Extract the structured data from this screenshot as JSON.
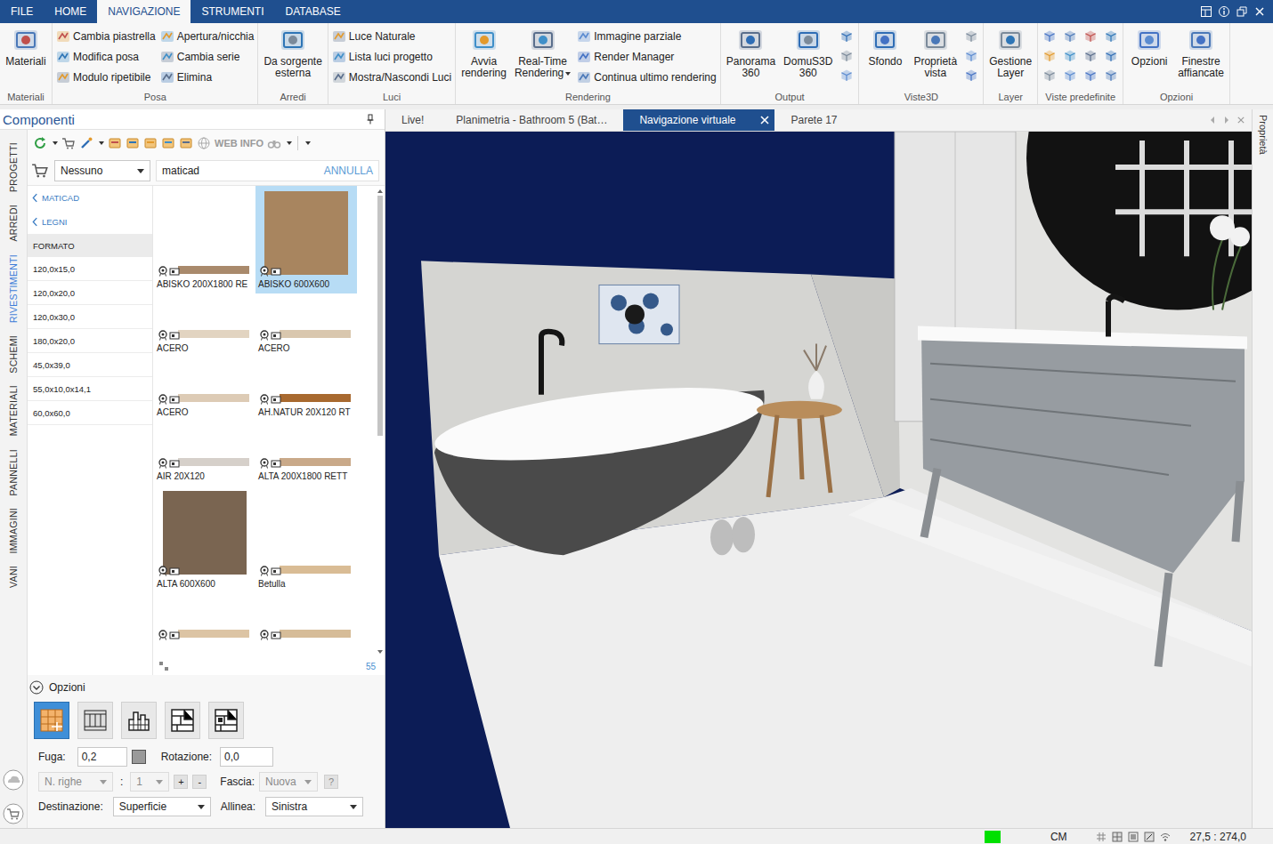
{
  "app_tabs": [
    {
      "label": "FILE",
      "selected": false
    },
    {
      "label": "HOME",
      "selected": false
    },
    {
      "label": "NAVIGAZIONE",
      "selected": true
    },
    {
      "label": "STRUMENTI",
      "selected": false
    },
    {
      "label": "DATABASE",
      "selected": false
    }
  ],
  "ribbon_groups": [
    {
      "title": "Materiali",
      "items": [
        {
          "kind": "large",
          "lines": [
            "Materiali"
          ],
          "dropdown": false
        }
      ]
    },
    {
      "title": "Posa",
      "items": [
        {
          "kind": "column",
          "buttons": [
            "Cambia piastrella",
            "Modifica posa",
            "Modulo ripetibile"
          ]
        },
        {
          "kind": "column",
          "buttons": [
            "Apertura/nicchia",
            "Cambia serie",
            "Elimina"
          ]
        }
      ]
    },
    {
      "title": "Arredi",
      "items": [
        {
          "kind": "large",
          "lines": [
            "Da sorgente",
            "esterna"
          ],
          "dropdown": false
        }
      ]
    },
    {
      "title": "Luci",
      "items": [
        {
          "kind": "column",
          "buttons": [
            "Luce Naturale",
            "Lista luci progetto",
            "Mostra/Nascondi Luci"
          ]
        }
      ]
    },
    {
      "title": "Rendering",
      "items": [
        {
          "kind": "large",
          "lines": [
            "Avvia",
            "rendering"
          ],
          "dropdown": false
        },
        {
          "kind": "large",
          "lines": [
            "Real-Time",
            "Rendering"
          ],
          "dropdown": true
        },
        {
          "kind": "column",
          "buttons": [
            "Immagine parziale",
            "Render Manager",
            "Continua ultimo rendering"
          ]
        }
      ]
    },
    {
      "title": "Output",
      "items": [
        {
          "kind": "large",
          "lines": [
            "Panorama",
            "360"
          ],
          "dropdown": false
        },
        {
          "kind": "large",
          "lines": [
            "DomuS3D",
            "360"
          ],
          "dropdown": false
        },
        {
          "kind": "icons",
          "columns": 1,
          "icons": 3
        }
      ]
    },
    {
      "title": "Viste3D",
      "items": [
        {
          "kind": "large",
          "lines": [
            "Sfondo"
          ],
          "dropdown": false
        },
        {
          "kind": "large",
          "lines": [
            "Proprietà",
            "vista"
          ],
          "dropdown": false
        },
        {
          "kind": "icons",
          "columns": 1,
          "icons": 3
        }
      ]
    },
    {
      "title": "Layer",
      "items": [
        {
          "kind": "large",
          "lines": [
            "Gestione",
            "Layer"
          ],
          "dropdown": false
        }
      ]
    },
    {
      "title": "Viste predefinite",
      "items": [
        {
          "kind": "icons",
          "columns": 4,
          "icons": 12
        }
      ]
    },
    {
      "title": "Opzioni",
      "items": [
        {
          "kind": "large",
          "lines": [
            "Opzioni"
          ],
          "dropdown": false
        },
        {
          "kind": "large",
          "lines": [
            "Finestre",
            "affiancate"
          ],
          "dropdown": false
        }
      ]
    }
  ],
  "panel": {
    "title": "Componenti",
    "side_tabs": [
      {
        "label": "PROGETTI",
        "selected": false
      },
      {
        "label": "ARREDI",
        "selected": false
      },
      {
        "label": "RIVESTIMENTI",
        "selected": true
      },
      {
        "label": "SCHEMI",
        "selected": false
      },
      {
        "label": "MATERIALI",
        "selected": false
      },
      {
        "label": "PANNELLI",
        "selected": false
      },
      {
        "label": "IMMAGINI",
        "selected": false
      },
      {
        "label": "VANI",
        "selected": false
      }
    ],
    "web_info": "WEB INFO",
    "filter": {
      "catalog": "Nessuno",
      "search": "maticad",
      "cancel": "ANNULLA"
    },
    "breadcrumbs": [
      "MATICAD",
      "LEGNI"
    ],
    "category": {
      "title": "FORMATO",
      "items": [
        "120,0x15,0",
        "120,0x20,0",
        "120,0x30,0",
        "180,0x20,0",
        "45,0x39,0",
        "55,0x10,0x14,1",
        "60,0x60,0"
      ]
    },
    "tiles": [
      {
        "name": "ABISKO 200X1800 RE",
        "kind": "strip",
        "color": "#a98a6c",
        "selected": false
      },
      {
        "name": "ABISKO 600X600",
        "kind": "square",
        "color": "#a8855f",
        "selected": true
      },
      {
        "name": "ACERO",
        "kind": "strip",
        "color": "#e2d4c1",
        "selected": false
      },
      {
        "name": "ACERO",
        "kind": "strip",
        "color": "#d9c7ae",
        "selected": false
      },
      {
        "name": "ACERO",
        "kind": "strip",
        "color": "#ddcbb5",
        "selected": false
      },
      {
        "name": "AH.NATUR 20X120 RT",
        "kind": "strip",
        "color": "#a8692f",
        "selected": false
      },
      {
        "name": "AIR 20X120",
        "kind": "strip",
        "color": "#d6d0ca",
        "selected": false
      },
      {
        "name": "ALTA 200X1800 RETT",
        "kind": "strip",
        "color": "#c9a989",
        "selected": false
      },
      {
        "name": "ALTA 600X600",
        "kind": "square",
        "color": "#7a6551",
        "selected": false
      },
      {
        "name": "Betulla",
        "kind": "strip",
        "color": "#d9bc95",
        "selected": false
      },
      {
        "name": "",
        "kind": "strip",
        "color": "#dcc4a4",
        "selected": false
      },
      {
        "name": "",
        "kind": "strip",
        "color": "#d6bc98",
        "selected": false
      }
    ],
    "tile_count": "55",
    "options": {
      "title": "Opzioni",
      "expanded": true,
      "layouts": [
        {
          "selected": true
        },
        {
          "selected": false
        },
        {
          "selected": false
        },
        {
          "selected": false
        },
        {
          "selected": false
        }
      ],
      "fuga": {
        "label": "Fuga:",
        "value": "0,2"
      },
      "rotazione": {
        "label": "Rotazione:",
        "value": "0,0"
      },
      "righe": {
        "placeholder": "N. righe",
        "disabled": true
      },
      "separator": ":",
      "count": {
        "value": "1",
        "disabled": true
      },
      "plus": "+",
      "minus": "-",
      "fascia": {
        "label": "Fascia:",
        "value": "Nuova",
        "disabled": true
      },
      "help": "?",
      "destinazione": {
        "label": "Destinazione:",
        "value": "Superficie"
      },
      "allinea": {
        "label": "Allinea:",
        "value": "Sinistra"
      }
    }
  },
  "document_tabs": [
    {
      "label": "Live!",
      "selected": false,
      "closable": false
    },
    {
      "label": "Planimetria - Bathroom 5 (Bat…",
      "selected": false,
      "closable": false
    },
    {
      "label": "Navigazione virtuale",
      "selected": true,
      "closable": true
    },
    {
      "label": "Parete 17",
      "selected": false,
      "closable": false
    }
  ],
  "properties_tab": "Proprietà",
  "status_bar": {
    "indicator_color": "#00e000",
    "unit": "CM",
    "coordinates": "27,5 : 274,0"
  }
}
